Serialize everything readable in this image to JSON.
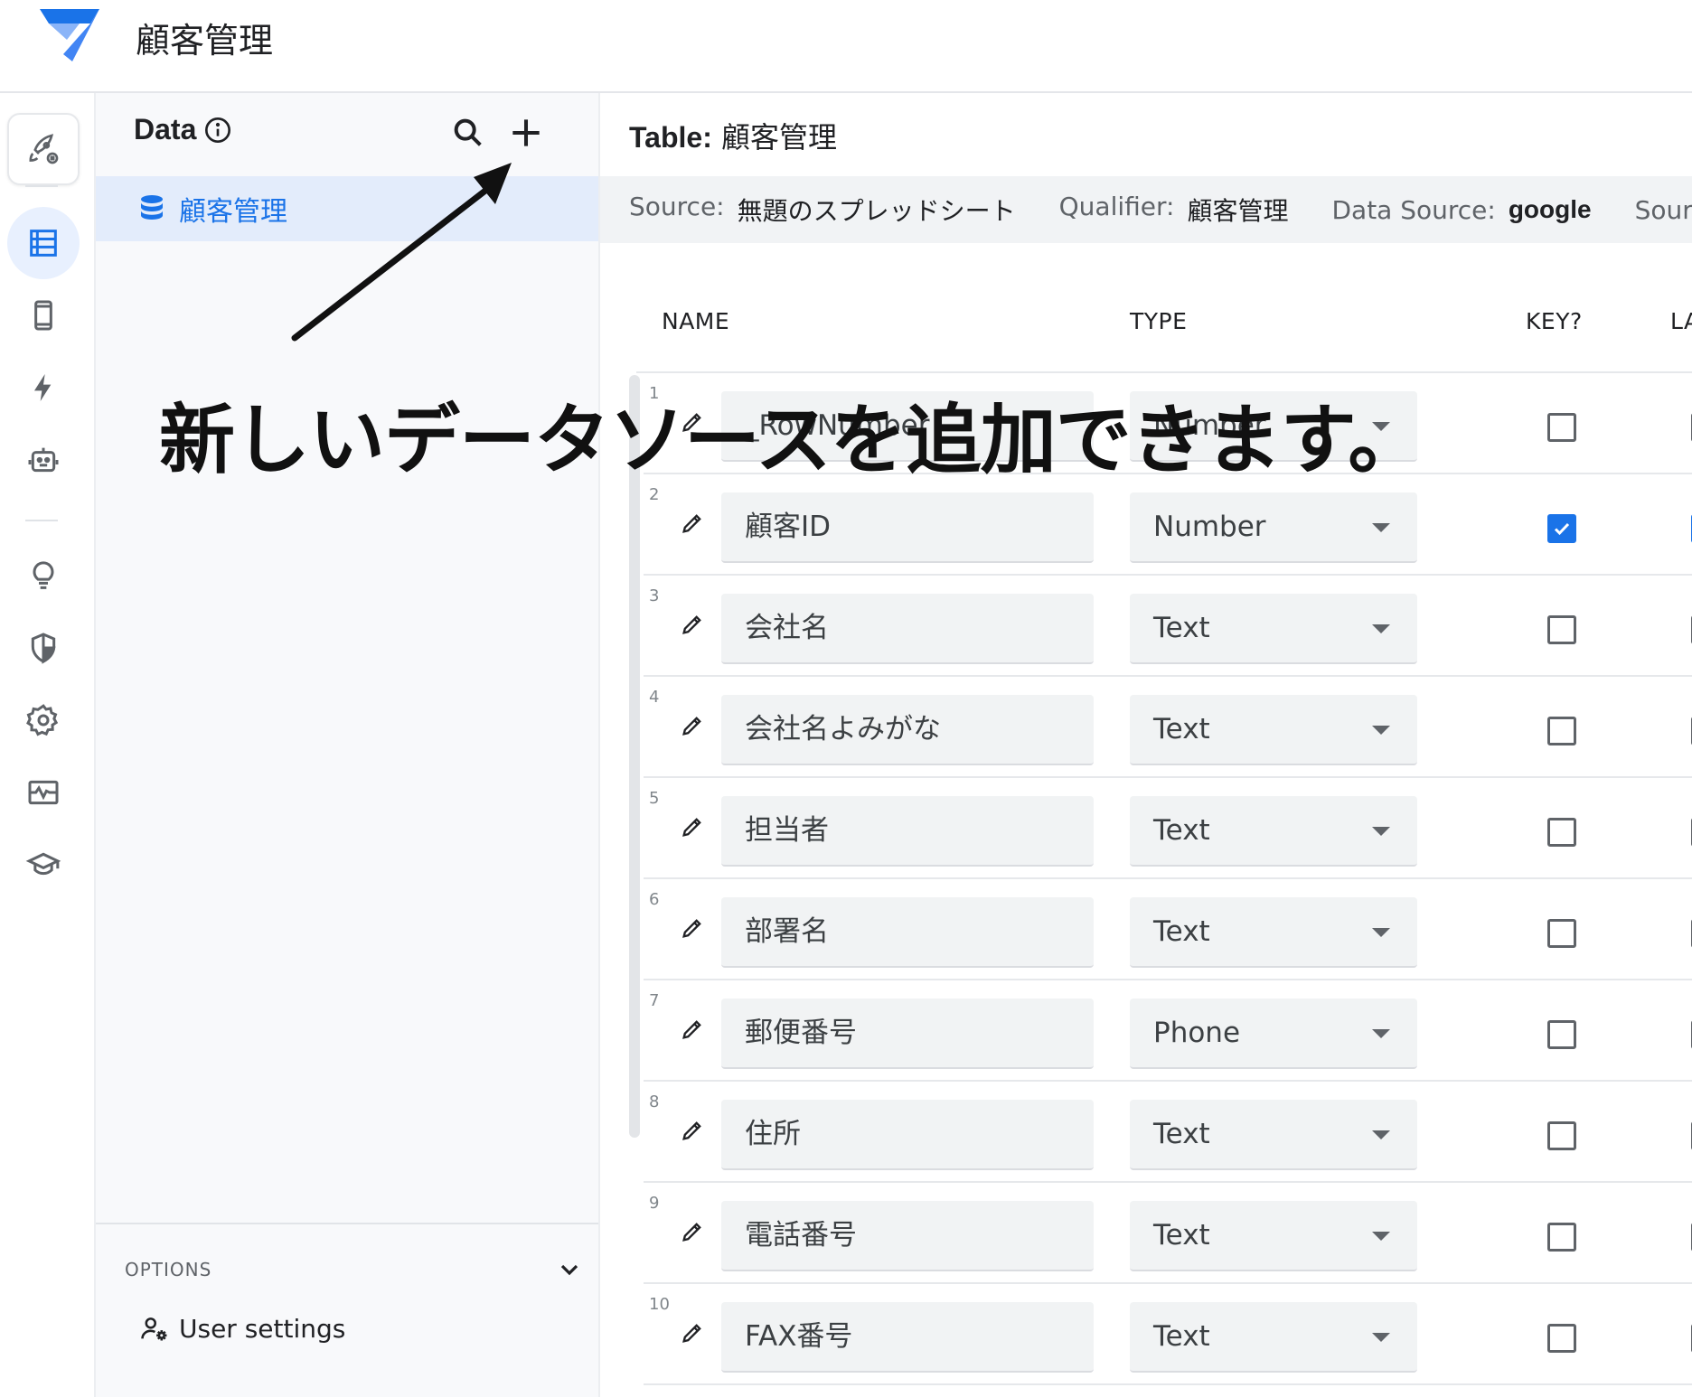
{
  "app": {
    "title": "顧客管理"
  },
  "colors": {
    "accent": "#1a73e8",
    "selected_bg": "#e3ecfb"
  },
  "rail": {
    "items": [
      {
        "icon": "rocket-icon"
      },
      {
        "icon": "data-icon"
      },
      {
        "icon": "phone-icon"
      },
      {
        "icon": "bolt-icon"
      },
      {
        "icon": "bot-icon"
      },
      {
        "icon": "lightbulb-icon"
      },
      {
        "icon": "shield-icon"
      },
      {
        "icon": "gear-icon"
      },
      {
        "icon": "monitor-icon"
      },
      {
        "icon": "graduation-cap-icon"
      }
    ]
  },
  "panel": {
    "title": "Data",
    "table_item": "顧客管理",
    "options_label": "OPTIONS",
    "user_settings": "User settings"
  },
  "main": {
    "table_label": "Table:",
    "table_name": "顧客管理",
    "meta": {
      "source_label": "Source:",
      "source_value": "無題のスプレッドシート",
      "qualifier_label": "Qualifier:",
      "qualifier_value": "顧客管理",
      "data_source_label": "Data Source:",
      "data_source_value": "google",
      "source_extra_label": "Source"
    },
    "columns": [
      "NAME",
      "TYPE",
      "KEY?",
      "LABEL?"
    ],
    "rows": [
      {
        "num": "1",
        "name": "_RowNumber",
        "type": "Number",
        "key": false,
        "label": false
      },
      {
        "num": "2",
        "name": "顧客ID",
        "type": "Number",
        "key": true,
        "label": true
      },
      {
        "num": "3",
        "name": "会社名",
        "type": "Text",
        "key": false,
        "label": false
      },
      {
        "num": "4",
        "name": "会社名よみがな",
        "type": "Text",
        "key": false,
        "label": false
      },
      {
        "num": "5",
        "name": "担当者",
        "type": "Text",
        "key": false,
        "label": false
      },
      {
        "num": "6",
        "name": "部署名",
        "type": "Text",
        "key": false,
        "label": false
      },
      {
        "num": "7",
        "name": "郵便番号",
        "type": "Phone",
        "key": false,
        "label": false
      },
      {
        "num": "8",
        "name": "住所",
        "type": "Text",
        "key": false,
        "label": false
      },
      {
        "num": "9",
        "name": "電話番号",
        "type": "Text",
        "key": false,
        "label": false
      },
      {
        "num": "10",
        "name": "FAX番号",
        "type": "Text",
        "key": false,
        "label": false
      }
    ]
  },
  "annotation": "新しいデータソースを追加できます。"
}
